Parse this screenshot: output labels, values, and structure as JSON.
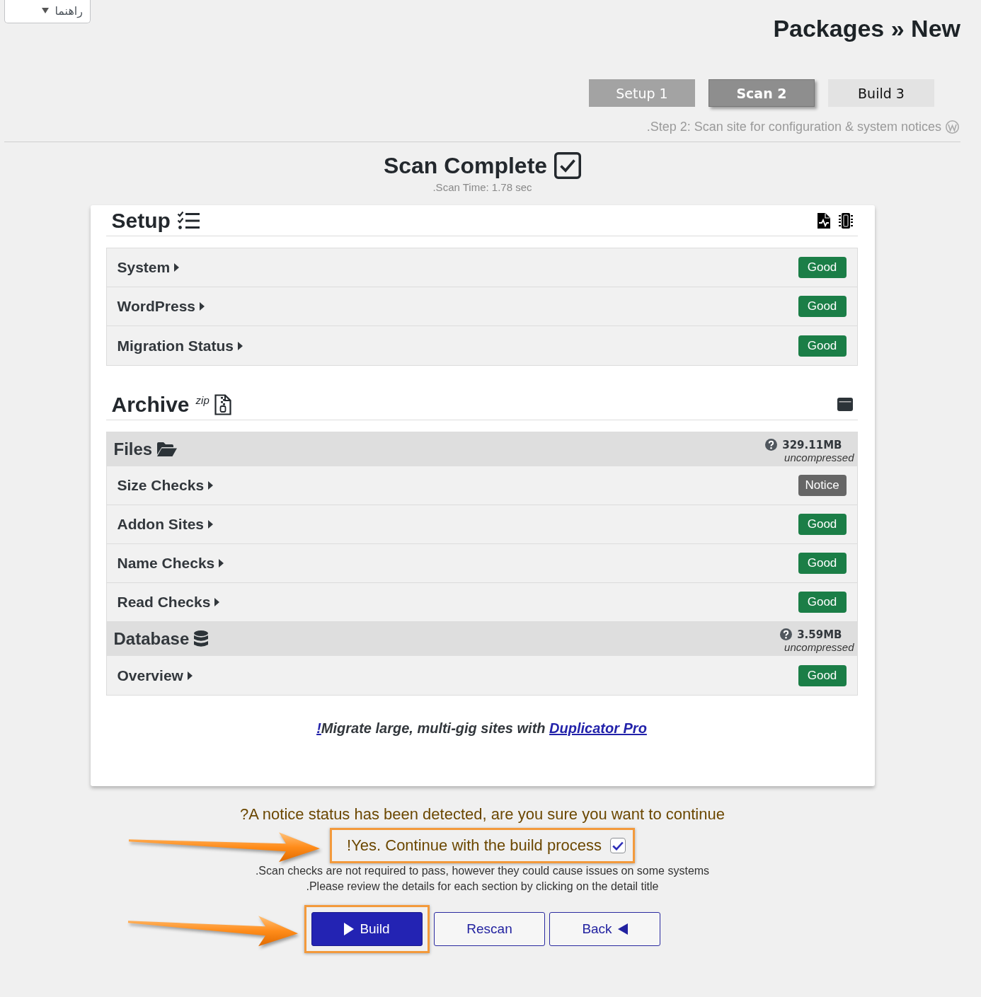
{
  "help_tab": {
    "label": "راهنما"
  },
  "page_title": "Packages » New",
  "steps": [
    {
      "label": "Setup 1",
      "selected": false,
      "completed": true
    },
    {
      "label": "Scan 2",
      "selected": true,
      "completed": false
    },
    {
      "label": "Build 3",
      "selected": false,
      "completed": false
    }
  ],
  "step_description": ".Step 2: Scan site for configuration & system notices",
  "scan": {
    "title": "Scan Complete",
    "time": ".Scan Time: 1.78 sec"
  },
  "sections": [
    {
      "kind": "setup",
      "title": "Setup",
      "groups": [
        {
          "items": [
            {
              "label": "System",
              "badge": "Good",
              "color": "#1b7e47"
            },
            {
              "label": "WordPress",
              "badge": "Good",
              "color": "#1b7e47"
            },
            {
              "label": "Migration Status",
              "badge": "Good",
              "color": "#1b7e47"
            }
          ]
        }
      ]
    },
    {
      "kind": "archive",
      "title": "Archive",
      "format": "zip",
      "groups": [
        {
          "kind": "files",
          "title": "Files",
          "size": "329.11MB",
          "size_note": "uncompressed",
          "items": [
            {
              "label": "Size Checks",
              "badge": "Notice",
              "color": "#666666"
            },
            {
              "label": "Addon Sites",
              "badge": "Good",
              "color": "#1b7e47"
            },
            {
              "label": "Name Checks",
              "badge": "Good",
              "color": "#1b7e47"
            },
            {
              "label": "Read Checks",
              "badge": "Good",
              "color": "#1b7e47"
            }
          ]
        },
        {
          "kind": "database",
          "title": "Database",
          "size": "3.59MB",
          "size_note": "uncompressed",
          "items": [
            {
              "label": "Overview",
              "badge": "Good",
              "color": "#1b7e47"
            }
          ]
        }
      ]
    }
  ],
  "promo": {
    "mark": "!",
    "text": "Migrate large, multi-gig sites with",
    "link": "Duplicator Pro"
  },
  "confirmation": {
    "question": "?A notice status has been detected, are you sure you want to continue",
    "label": "!Yes. Continue with the build process",
    "checked": true,
    "highlighted": true
  },
  "hints": [
    ".Scan checks are not required to pass, however they could cause issues on some systems",
    ".Please review the details for each section by clicking on the detail title"
  ],
  "buttons": [
    {
      "kind": "primary",
      "label": "Build",
      "highlighted": true
    },
    {
      "kind": "secondary",
      "label": "Rescan",
      "highlighted": false
    },
    {
      "kind": "back",
      "label": "Back",
      "highlighted": false
    }
  ]
}
